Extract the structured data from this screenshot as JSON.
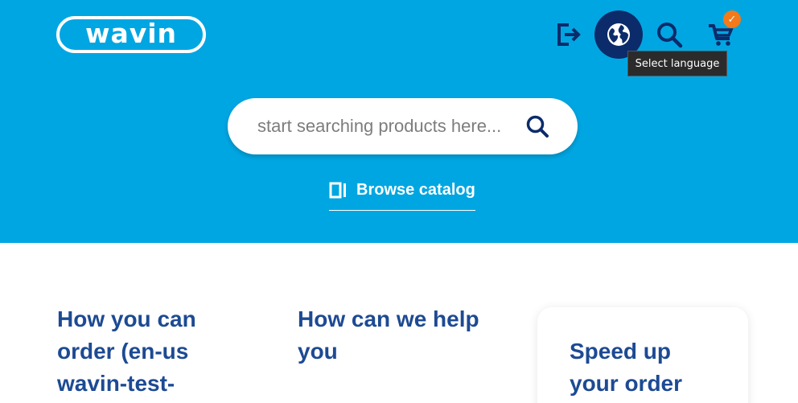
{
  "header": {
    "logo_text": "wavin",
    "tooltip": "Select language",
    "cart_badge": "✓",
    "icons": [
      "logout-icon",
      "globe-icon",
      "search-icon",
      "cart-icon"
    ]
  },
  "search": {
    "placeholder": "start searching products here..."
  },
  "browse": {
    "label": "Browse catalog"
  },
  "content": {
    "col1_title": "How you can order (en-us wavin-test-",
    "col2_title": "How can we help you",
    "card_title": "Speed up your order"
  },
  "colors": {
    "hero_bg": "#00a6e2",
    "navy": "#0c2b6a",
    "heading_blue": "#1d4a93",
    "badge_orange": "#f27a1a"
  }
}
